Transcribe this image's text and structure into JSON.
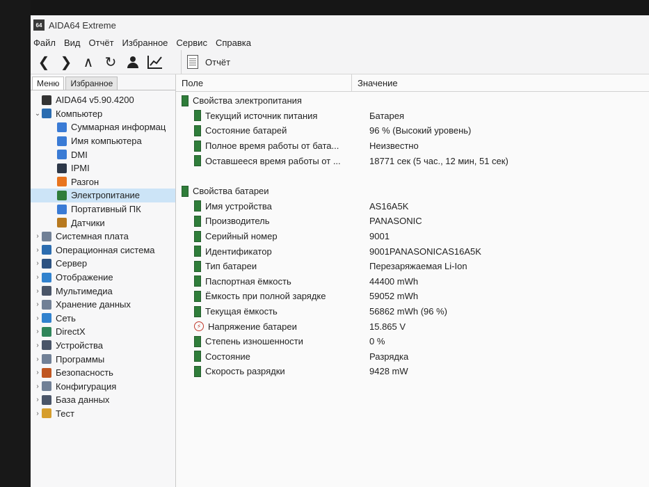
{
  "window": {
    "title": "AIDA64 Extreme",
    "icon_label": "64"
  },
  "menu": [
    "Файл",
    "Вид",
    "Отчёт",
    "Избранное",
    "Сервис",
    "Справка"
  ],
  "toolbar": {
    "report_label": "Отчёт"
  },
  "sidebar": {
    "tabs": [
      "Меню",
      "Избранное"
    ],
    "tree": [
      {
        "label": "AIDA64 v5.90.4200",
        "level": 0,
        "arrow": "",
        "icon": "aida64-icon",
        "color": "#333333"
      },
      {
        "label": "Компьютер",
        "level": 0,
        "arrow": "⌄",
        "icon": "computer-icon",
        "color": "#2b6cb0"
      },
      {
        "label": "Суммарная информац",
        "level": 1,
        "arrow": "",
        "icon": "summary-icon",
        "color": "#3a7bd5"
      },
      {
        "label": "Имя компьютера",
        "level": 1,
        "arrow": "",
        "icon": "computer-name-icon",
        "color": "#3a7bd5"
      },
      {
        "label": "DMI",
        "level": 1,
        "arrow": "",
        "icon": "dmi-icon",
        "color": "#3a7bd5"
      },
      {
        "label": "IPMI",
        "level": 1,
        "arrow": "",
        "icon": "ipmi-icon",
        "color": "#2d3748"
      },
      {
        "label": "Разгон",
        "level": 1,
        "arrow": "",
        "icon": "overclock-icon",
        "color": "#e8741e"
      },
      {
        "label": "Электропитание",
        "level": 1,
        "arrow": "",
        "icon": "power-icon",
        "color": "#2f7d3a",
        "selected": true
      },
      {
        "label": "Портативный ПК",
        "level": 1,
        "arrow": "",
        "icon": "portable-pc-icon",
        "color": "#3a7bd5"
      },
      {
        "label": "Датчики",
        "level": 1,
        "arrow": "",
        "icon": "sensors-icon",
        "color": "#b7791f"
      },
      {
        "label": "Системная плата",
        "level": 0,
        "arrow": "›",
        "icon": "motherboard-icon",
        "color": "#718096"
      },
      {
        "label": "Операционная система",
        "level": 0,
        "arrow": "›",
        "icon": "os-icon",
        "color": "#2b6cb0"
      },
      {
        "label": "Сервер",
        "level": 0,
        "arrow": "›",
        "icon": "server-icon",
        "color": "#2c5282"
      },
      {
        "label": "Отображение",
        "level": 0,
        "arrow": "›",
        "icon": "display-icon",
        "color": "#3182ce"
      },
      {
        "label": "Мультимедиа",
        "level": 0,
        "arrow": "›",
        "icon": "multimedia-icon",
        "color": "#4a5568"
      },
      {
        "label": "Хранение данных",
        "level": 0,
        "arrow": "›",
        "icon": "storage-icon",
        "color": "#718096"
      },
      {
        "label": "Сеть",
        "level": 0,
        "arrow": "›",
        "icon": "network-icon",
        "color": "#3182ce"
      },
      {
        "label": "DirectX",
        "level": 0,
        "arrow": "›",
        "icon": "directx-icon",
        "color": "#2f855a"
      },
      {
        "label": "Устройства",
        "level": 0,
        "arrow": "›",
        "icon": "devices-icon",
        "color": "#4a5568"
      },
      {
        "label": "Программы",
        "level": 0,
        "arrow": "›",
        "icon": "programs-icon",
        "color": "#718096"
      },
      {
        "label": "Безопасность",
        "level": 0,
        "arrow": "›",
        "icon": "security-icon",
        "color": "#c05621"
      },
      {
        "label": "Конфигурация",
        "level": 0,
        "arrow": "›",
        "icon": "configuration-icon",
        "color": "#718096"
      },
      {
        "label": "База данных",
        "level": 0,
        "arrow": "›",
        "icon": "database-icon",
        "color": "#4a5568"
      },
      {
        "label": "Тест",
        "level": 0,
        "arrow": "›",
        "icon": "test-icon",
        "color": "#d69e2e"
      }
    ]
  },
  "table": {
    "columns": [
      "Поле",
      "Значение"
    ],
    "sections": [
      {
        "title": "Свойства электропитания",
        "rows": [
          {
            "field": "Текущий источник питания",
            "value": "Батарея",
            "icon": "battery-icon"
          },
          {
            "field": "Состояние батарей",
            "value": "96 % (Высокий уровень)",
            "icon": "battery-icon"
          },
          {
            "field": "Полное время работы от бата...",
            "value": "Неизвестно",
            "icon": "battery-icon"
          },
          {
            "field": "Оставшееся время работы от ...",
            "value": "18771 сек (5 час., 12 мин, 51 сек)",
            "icon": "battery-icon"
          }
        ]
      },
      {
        "title": "Свойства батареи",
        "rows": [
          {
            "field": "Имя устройства",
            "value": "AS16A5K",
            "icon": "battery-icon"
          },
          {
            "field": "Производитель",
            "value": "PANASONIC",
            "icon": "battery-icon"
          },
          {
            "field": "Серийный номер",
            "value": "9001",
            "icon": "battery-icon"
          },
          {
            "field": "Идентификатор",
            "value": "9001PANASONICAS16A5K",
            "icon": "battery-icon"
          },
          {
            "field": "Тип батареи",
            "value": "Перезаряжаемая Li-Ion",
            "icon": "battery-icon"
          },
          {
            "field": "Паспортная ёмкость",
            "value": "44400 mWh",
            "icon": "battery-icon"
          },
          {
            "field": "Ёмкость при полной зарядке",
            "value": "59052 mWh",
            "icon": "battery-icon"
          },
          {
            "field": "Текущая ёмкость",
            "value": "56862 mWh  (96 %)",
            "icon": "battery-icon"
          },
          {
            "field": "Напряжение батареи",
            "value": "15.865 V",
            "icon": "voltage-icon"
          },
          {
            "field": "Степень изношенности",
            "value": "0 %",
            "icon": "battery-icon"
          },
          {
            "field": "Состояние",
            "value": "Разрядка",
            "icon": "battery-icon"
          },
          {
            "field": "Скорость разрядки",
            "value": "9428 mW",
            "icon": "battery-icon"
          }
        ]
      }
    ]
  }
}
